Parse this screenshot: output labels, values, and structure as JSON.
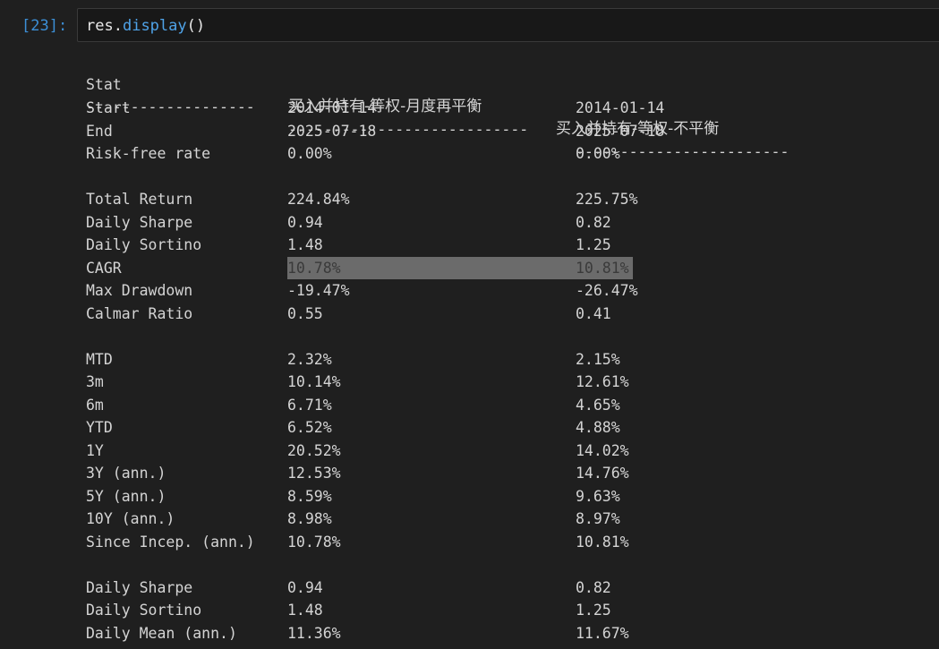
{
  "cell": {
    "prompt": "[23]:",
    "code_var": "res",
    "code_dot": ".",
    "code_fn": "display",
    "code_parens": "()"
  },
  "table": {
    "header": [
      "Stat",
      "买入并持有-等权-月度再平衡",
      "买入并持有-等权-不平衡"
    ],
    "separators": [
      "-------------------",
      "---------------------------",
      "------------------------"
    ],
    "rows": [
      [
        "Start",
        "2014-01-14",
        "2014-01-14"
      ],
      [
        "End",
        "2025-07-18",
        "2025-07-18"
      ],
      [
        "Risk-free rate",
        "0.00%",
        "0.00%"
      ],
      [
        "",
        "",
        ""
      ],
      [
        "Total Return",
        "224.84%",
        "225.75%"
      ],
      [
        "Daily Sharpe",
        "0.94",
        "0.82"
      ],
      [
        "Daily Sortino",
        "1.48",
        "1.25"
      ],
      [
        "CAGR",
        "10.78%",
        "10.81%"
      ],
      [
        "Max Drawdown",
        "-19.47%",
        "-26.47%"
      ],
      [
        "Calmar Ratio",
        "0.55",
        "0.41"
      ],
      [
        "",
        "",
        ""
      ],
      [
        "MTD",
        "2.32%",
        "2.15%"
      ],
      [
        "3m",
        "10.14%",
        "12.61%"
      ],
      [
        "6m",
        "6.71%",
        "4.65%"
      ],
      [
        "YTD",
        "6.52%",
        "4.88%"
      ],
      [
        "1Y",
        "20.52%",
        "14.02%"
      ],
      [
        "3Y (ann.)",
        "12.53%",
        "14.76%"
      ],
      [
        "5Y (ann.)",
        "8.59%",
        "9.63%"
      ],
      [
        "10Y (ann.)",
        "8.98%",
        "8.97%"
      ],
      [
        "Since Incep. (ann.)",
        "10.78%",
        "10.81%"
      ],
      [
        "",
        "",
        ""
      ],
      [
        "Daily Sharpe",
        "0.94",
        "0.82"
      ],
      [
        "Daily Sortino",
        "1.48",
        "1.25"
      ],
      [
        "Daily Mean (ann.)",
        "11.36%",
        "11.67%"
      ]
    ],
    "highlighted_row_index": 7
  },
  "colors": {
    "background": "#1f1f1f",
    "prompt": "#3c8fd6",
    "function": "#4fa3e8",
    "text": "#d4d4d4",
    "selection": "#6b6b6b"
  }
}
